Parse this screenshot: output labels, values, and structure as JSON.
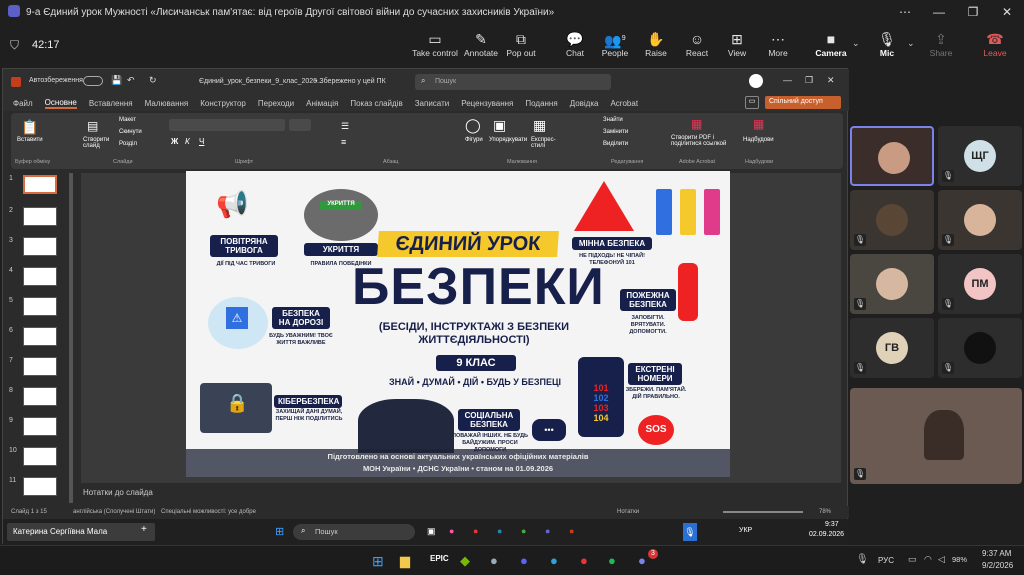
{
  "window": {
    "title": "9-а Єдиний урок Мужності «Лисичанськ пам'ятає: від героїв Другої світової війни до сучасних захисників України»",
    "timer": "42:17"
  },
  "toolbar": {
    "take_control": "Take control",
    "annotate": "Annotate",
    "pop_out": "Pop out",
    "chat": "Chat",
    "people": "People",
    "people_count": "9",
    "raise": "Raise",
    "react": "React",
    "view": "View",
    "more": "More",
    "camera": "Camera",
    "mic": "Mic",
    "share": "Share",
    "leave": "Leave"
  },
  "ppt": {
    "autosave": "Автозбереження",
    "filename": "Єдиний_урок_безпеки_9_клас_2026...",
    "saved": "• Збережено у цей ПК",
    "search_placeholder": "Пошук",
    "tabs": [
      "Файл",
      "Основне",
      "Вставлення",
      "Малювання",
      "Конструктор",
      "Переходи",
      "Анімація",
      "Показ слайдів",
      "Записати",
      "Рецензування",
      "Подання",
      "Довідка",
      "Acrobat"
    ],
    "share_button": "Спільний доступ",
    "ribbon_groups": [
      "Буфер обміну",
      "Слайди",
      "Шрифт",
      "Абзац",
      "Малювання",
      "Редагування",
      "Adobe Acrobat",
      "Надбудови"
    ],
    "ribbon_items": {
      "paste": "Вставити",
      "new_slide": "Створити слайд",
      "layout": "Макет",
      "reset": "Скинути",
      "section": "Розділ",
      "shapes": "Фігури",
      "arrange": "Упорядкувати",
      "quick_styles": "Експрес-стилі",
      "find": "Знайти",
      "replace": "Замінити",
      "select": "Виділити",
      "pdf": "Створити PDF і поділитися ссылкой",
      "addins": "Надбудови"
    },
    "notes": "Нотатки до слайда",
    "status_slide": "Слайд 1 з 15",
    "status_lang": "англійська (Сполучені Штати)",
    "status_access": "Спеціальні можливості: усе добре",
    "status_notes": "Нотатки",
    "zoom": "78%",
    "thumb_numbers": [
      "1",
      "2",
      "3",
      "4",
      "5",
      "6",
      "7",
      "8",
      "9",
      "10",
      "11"
    ]
  },
  "slide": {
    "alarm_title": "ПОВІТРЯНА ТРИВОГА",
    "alarm_sub": "ДІЇ ПІД ЧАС ТРИВОГИ",
    "shelter_sign": "УКРИТТЯ",
    "shelter_title": "УКРИТТЯ",
    "shelter_sub": "ПРАВИЛА ПОВЕДІНКИ",
    "headline1": "ЄДИНИЙ УРОК",
    "headline2": "БЕЗПЕКИ",
    "subtitle": "(БЕСІДИ, ІНСТРУКТАЖІ З БЕЗПЕКИ ЖИТТЄДІЯЛЬНОСТІ)",
    "grade": "9 КЛАС",
    "motto": "ЗНАЙ • ДУМАЙ • ДІЙ • БУДЬ У БЕЗПЕЦІ",
    "mine_title": "МІННА БЕЗПЕКА",
    "mine_sub": "НЕ ПІДХОДЬ! НЕ ЧІПАЙ! ТЕЛЕФОНУЙ 101",
    "road_title": "БЕЗПЕКА НА ДОРОЗІ",
    "road_sub": "БУДЬ УВАЖНИМ! ТВОЄ ЖИТТЯ ВАЖЛИВЕ",
    "fire_title": "ПОЖЕЖНА БЕЗПЕКА",
    "fire_sub": "ЗАПОБІГТИ. ВРЯТУВАТИ. ДОПОМОГТИ.",
    "cyber_title": "КІБЕРБЕЗПЕКА",
    "cyber_sub": "ЗАХИЩАЙ ДАНІ ДУМАЙ, ПЕРШ НІЖ ПОДІЛИТИСЬ",
    "social_title": "СОЦІАЛЬНА БЕЗПЕКА",
    "social_sub": "ПОВАЖАЙ ІНШИХ. НЕ БУДЬ БАЙДУЖИМ. ПРОСИ ДОПОМОГИ",
    "emergency_title": "ЕКСТРЕНІ НОМЕРИ",
    "emergency_sub": "ЗБЕРЕЖИ. ПАМ'ЯТАЙ. ДІЙ ПРАВИЛЬНО.",
    "numbers": [
      "101",
      "102",
      "103",
      "104"
    ],
    "sos": "SOS",
    "footer1": "Підготовлено на основі актуальних українських офіційних матеріалів",
    "footer2": "МОН України • ДСНС України • станом на 01.09.2026"
  },
  "presenter": {
    "name": "Катерина Сергіївна Мала"
  },
  "inner_taskbar": {
    "search": "Пошук",
    "lang": "УКР",
    "time": "9:37",
    "date": "02.09.2026"
  },
  "participants": [
    {
      "initials": "",
      "color": "#3a3a3a"
    },
    {
      "initials": "ЩГ",
      "color": "#cfe0e6"
    },
    {
      "initials": "",
      "color": "#3a3a3a"
    },
    {
      "initials": "",
      "color": "#3a3a3a"
    },
    {
      "initials": "",
      "color": "#3a3a3a"
    },
    {
      "initials": "ПМ",
      "color": "#f2c4c4"
    },
    {
      "initials": "ГВ",
      "color": "#e0d2b8"
    },
    {
      "initials": "",
      "color": "#111111"
    }
  ],
  "taskbar": {
    "lang": "РУС",
    "battery": "98%",
    "time": "9:37 AM",
    "date": "9/2/2026",
    "badge": "3"
  }
}
